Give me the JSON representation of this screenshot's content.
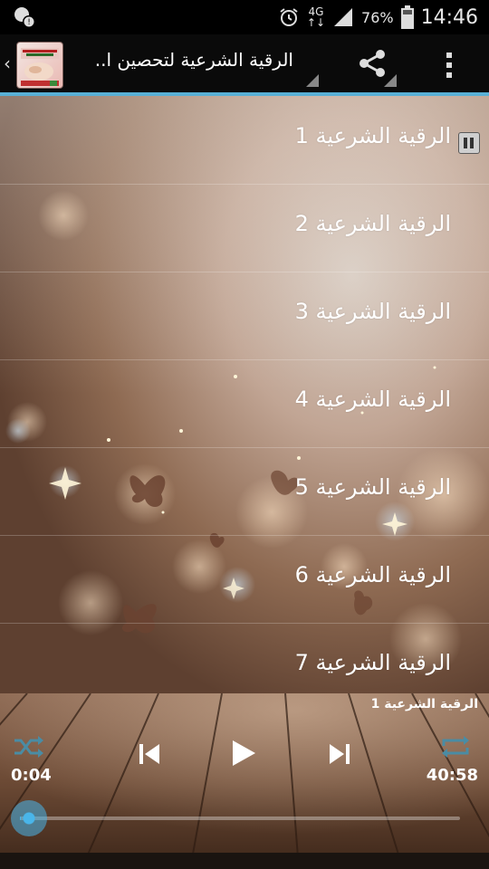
{
  "status_bar": {
    "network": "4G",
    "battery": "76%",
    "time": "14:46",
    "icons": [
      "notification-icon",
      "alarm-icon",
      "network-4g-icon",
      "signal-icon",
      "battery-icon"
    ]
  },
  "action_bar": {
    "title": "الرقية الشرعية لتحصين ا..",
    "icons": [
      "back-chevron-icon",
      "app-logo-icon",
      "share-icon",
      "overflow-menu-icon"
    ]
  },
  "tracks": [
    {
      "label": "الرقية الشرعية 1",
      "playing": true
    },
    {
      "label": "الرقية الشرعية 2",
      "playing": false
    },
    {
      "label": "الرقية الشرعية 3",
      "playing": false
    },
    {
      "label": "الرقية الشرعية 4",
      "playing": false
    },
    {
      "label": "الرقية الشرعية 5",
      "playing": false
    },
    {
      "label": "الرقية الشرعية 6",
      "playing": false
    },
    {
      "label": "الرقية الشرعية 7",
      "playing": false
    }
  ],
  "player": {
    "now_playing": "الرقية الشرعية 1",
    "elapsed": "0:04",
    "total": "40:58",
    "progress": 0.0016,
    "icons": [
      "shuffle-icon",
      "previous-icon",
      "play-icon",
      "next-icon",
      "repeat-icon"
    ]
  },
  "colors": {
    "accent": "#58b0d6",
    "seek": "#4fb8e8"
  }
}
